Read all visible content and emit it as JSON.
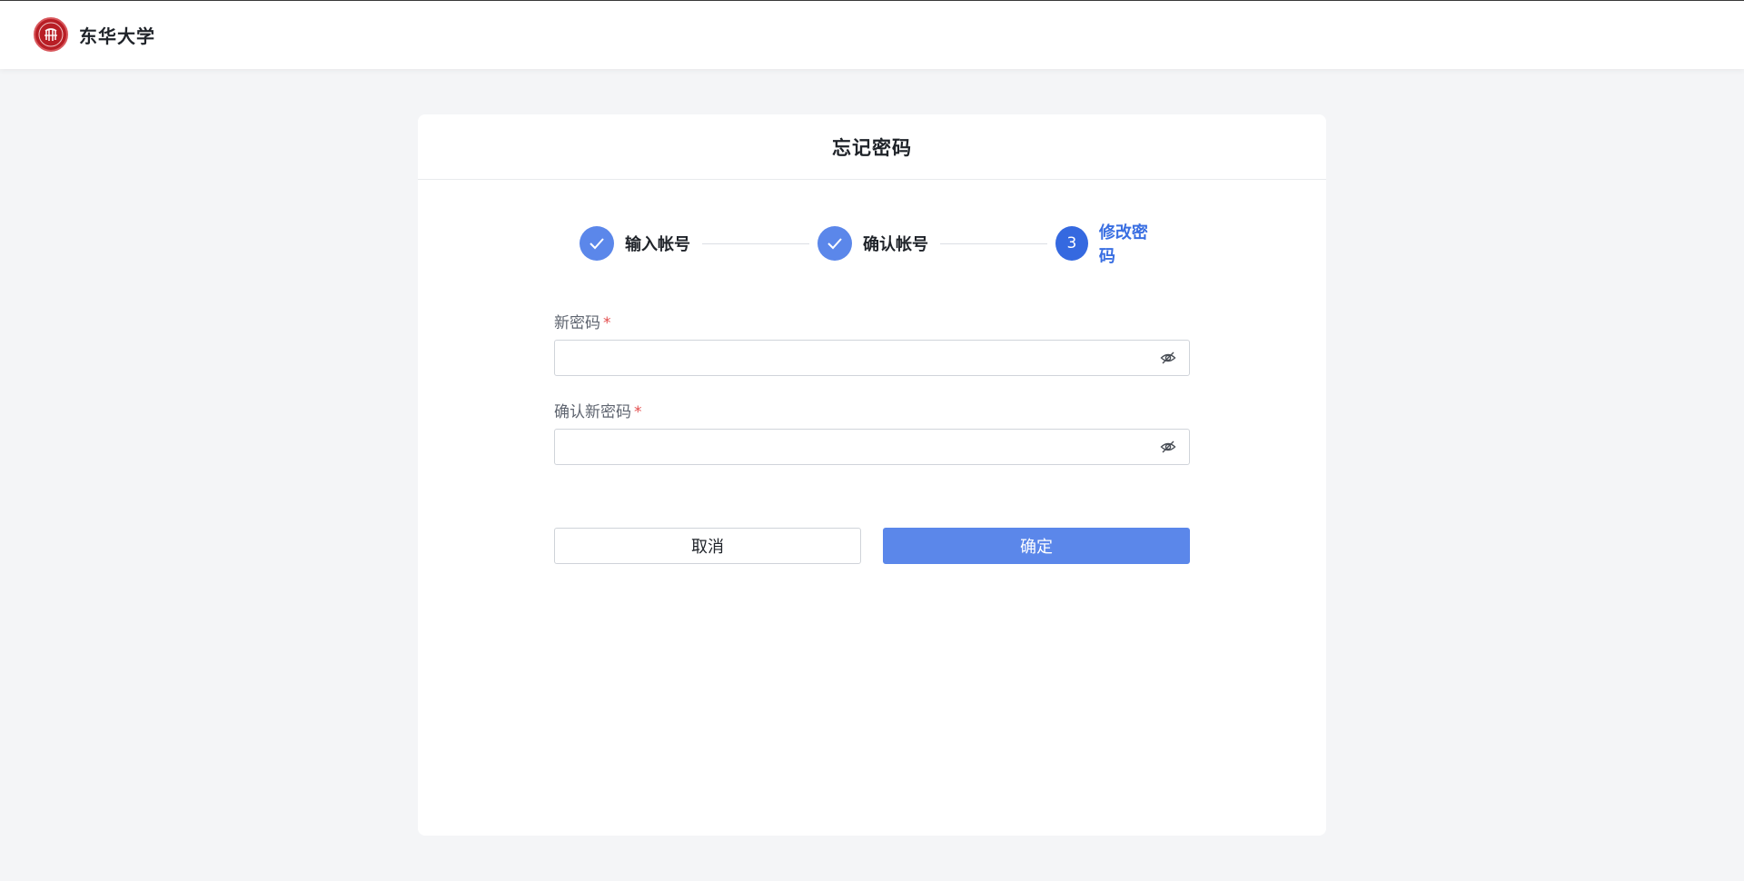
{
  "header": {
    "brand_name": "东华大学"
  },
  "card": {
    "title": "忘记密码"
  },
  "steps": [
    {
      "label": "输入帐号",
      "status": "done"
    },
    {
      "label": "确认帐号",
      "status": "done"
    },
    {
      "label": "修改密码",
      "status": "active",
      "number": "3"
    }
  ],
  "form": {
    "new_password": {
      "label": "新密码",
      "required_mark": "*",
      "value": ""
    },
    "confirm_password": {
      "label": "确认新密码",
      "required_mark": "*",
      "value": ""
    }
  },
  "buttons": {
    "cancel_label": "取消",
    "confirm_label": "确定"
  },
  "colors": {
    "accent": "#3a6fe2",
    "done_step": "#5b87ea",
    "primary_button": "#5b87ea",
    "required": "#e34d4d",
    "brand_red": "#b81e25"
  }
}
